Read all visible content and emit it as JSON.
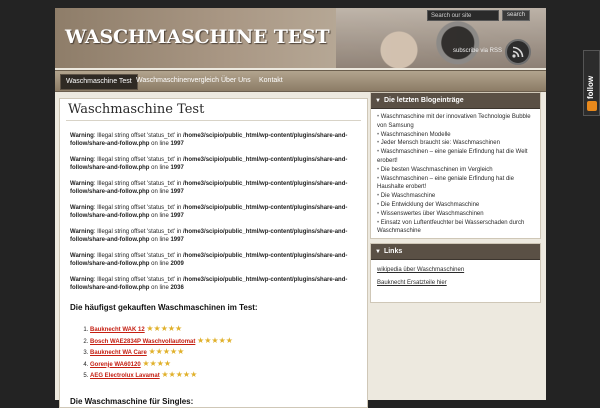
{
  "header": {
    "site_title": "WASCHMASCHINE TEST",
    "search_placeholder": "Search our site",
    "search_button": "search",
    "subscribe_text": "subscribe via RSS"
  },
  "nav": {
    "items": [
      {
        "label": "Waschmaschine Test",
        "active": true
      },
      {
        "label": "Waschmaschinenvergleich",
        "active": false
      },
      {
        "label": "Über Uns",
        "active": false
      },
      {
        "label": "Kontakt",
        "active": false
      }
    ]
  },
  "main": {
    "title": "Waschmaschine Test",
    "warnings": [
      {
        "label": "Warning",
        "text": ": Illegal string offset 'status_txt' in ",
        "path": "/home3/scipio/public_html/wp-content/plugins/share-and-follow/share-and-follow.php",
        "suffix": " on line ",
        "line": "1997"
      },
      {
        "label": "Warning",
        "text": ": Illegal string offset 'status_txt' in ",
        "path": "/home3/scipio/public_html/wp-content/plugins/share-and-follow/share-and-follow.php",
        "suffix": " on line ",
        "line": "1997"
      },
      {
        "label": "Warning",
        "text": ": Illegal string offset 'status_txt' in ",
        "path": "/home3/scipio/public_html/wp-content/plugins/share-and-follow/share-and-follow.php",
        "suffix": " on line ",
        "line": "1997"
      },
      {
        "label": "Warning",
        "text": ": Illegal string offset 'status_txt' in ",
        "path": "/home3/scipio/public_html/wp-content/plugins/share-and-follow/share-and-follow.php",
        "suffix": " on line ",
        "line": "1997"
      },
      {
        "label": "Warning",
        "text": ": Illegal string offset 'status_txt' in ",
        "path": "/home3/scipio/public_html/wp-content/plugins/share-and-follow/share-and-follow.php",
        "suffix": " on line ",
        "line": "1997"
      },
      {
        "label": "Warning",
        "text": ": Illegal string offset 'status_txt' in ",
        "path": "/home3/scipio/public_html/wp-content/plugins/share-and-follow/share-and-follow.php",
        "suffix": " on line ",
        "line": "2009"
      },
      {
        "label": "Warning",
        "text": ": Illegal string offset 'status_txt' in ",
        "path": "/home3/scipio/public_html/wp-content/plugins/share-and-follow/share-and-follow.php",
        "suffix": " on line ",
        "line": "2036"
      }
    ],
    "top_heading": "Die häufigst gekauften Waschmaschinen im Test:",
    "top_list": [
      {
        "name": "Bauknecht WAK 12",
        "stars": "★★★★★"
      },
      {
        "name": "Bosch WAE2834P Waschvollautomat",
        "stars": "★★★★★"
      },
      {
        "name": "Bauknecht WA Care",
        "stars": "★★★★★"
      },
      {
        "name": "Gorenje WA60120",
        "stars": "★★★★"
      },
      {
        "name": "AEG Electrolux Lavamat",
        "stars": "★★★★★"
      }
    ],
    "singles_heading": "Die Waschmaschine für Singles:"
  },
  "sidebar": {
    "blog_title": "Die letzten Blogeinträge",
    "blog_posts": [
      "Waschmaschine mit der innovativen Technologie Bubble von Samsung",
      "Waschmaschinen Modelle",
      "Jeder Mensch braucht sie: Waschmaschinen",
      "Waschmaschinen – eine geniale Erfindung hat die Welt erobert!",
      "Die besten Waschmaschinen im Vergleich",
      "Waschmaschinen – eine geniale Erfindung hat die Haushalte erobert!",
      "Die Waschmaschine",
      "Die Entwicklung der Waschmaschine",
      "Wissenswertes über Waschmaschinen",
      "Einsatz von Luftentfeuchter bei Wasserschaden durch Waschmaschine"
    ],
    "links_title": "Links",
    "links": [
      "wikipedia über Waschmaschinen",
      "Bauknecht Ersatzteile hier"
    ]
  },
  "follow_tab": {
    "label": "follow"
  },
  "colors": {
    "accent_red": "#c41d10",
    "sidebar_head": "#5a5045",
    "star": "#e0b02a"
  }
}
